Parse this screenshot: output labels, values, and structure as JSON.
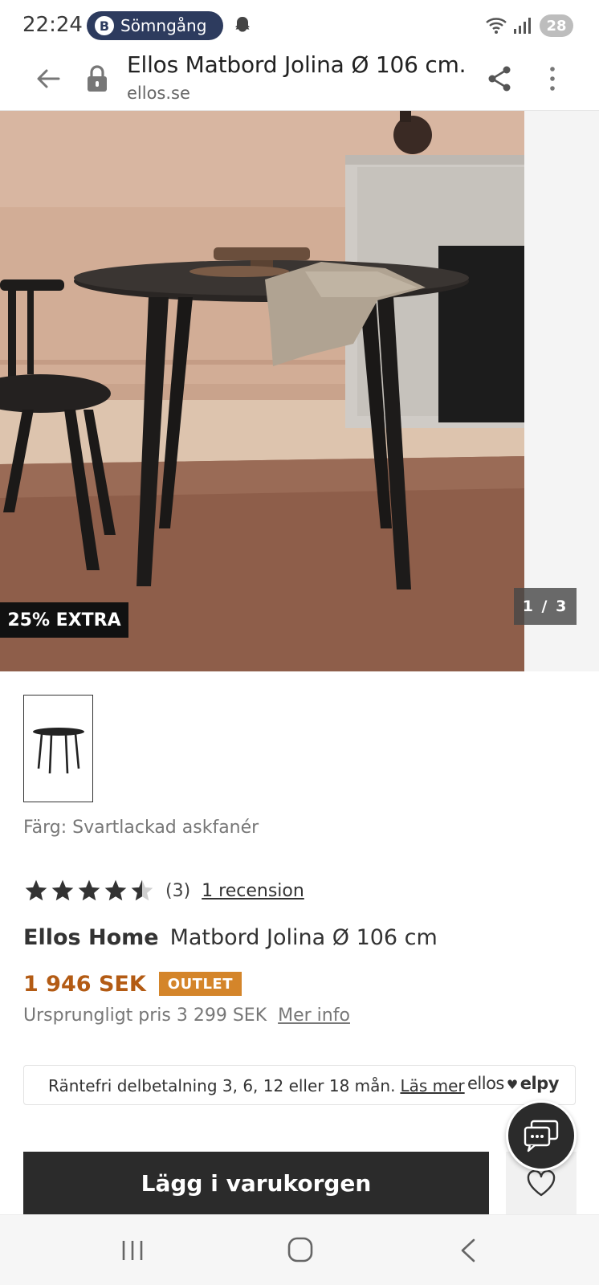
{
  "status_bar": {
    "time": "22:24",
    "notification_pill": "Sömngång",
    "pill_icon_letter": "B",
    "battery": "28",
    "icons": [
      "snapchat-ghost-icon",
      "wifi-icon",
      "signal-icon",
      "battery-icon"
    ]
  },
  "browser": {
    "title": "Ellos Matbord Jolina Ø 106 cm...",
    "url": "ellos.se",
    "icons": [
      "back-arrow-icon",
      "lock-icon",
      "share-icon",
      "more-vert-icon"
    ]
  },
  "gallery": {
    "badge": "25% EXTRA",
    "counter": "1 / 3"
  },
  "product": {
    "color_line": "Färg: Svartlackad askfanér",
    "rating_value": 4.5,
    "rating_count": "(3)",
    "reviews_link": "1 recension",
    "brand": "Ellos Home",
    "name": "Matbord Jolina Ø 106 cm",
    "price": "1 946 SEK",
    "price_badge": "OUTLET",
    "original_price": "Ursprungligt pris 3 299 SEK",
    "more_info_link": "Mer info"
  },
  "installment": {
    "text": "Räntefri delbetalning 3, 6, 12 eller 18 mån.",
    "link": "Läs mer",
    "logo_left": "ellos",
    "logo_right": "elpy"
  },
  "actions": {
    "add_to_cart": "Lägg i varukorgen"
  },
  "colors": {
    "price": "#b35b14",
    "outlet_badge": "#d4852a",
    "button_dark": "#2b2b2b"
  }
}
